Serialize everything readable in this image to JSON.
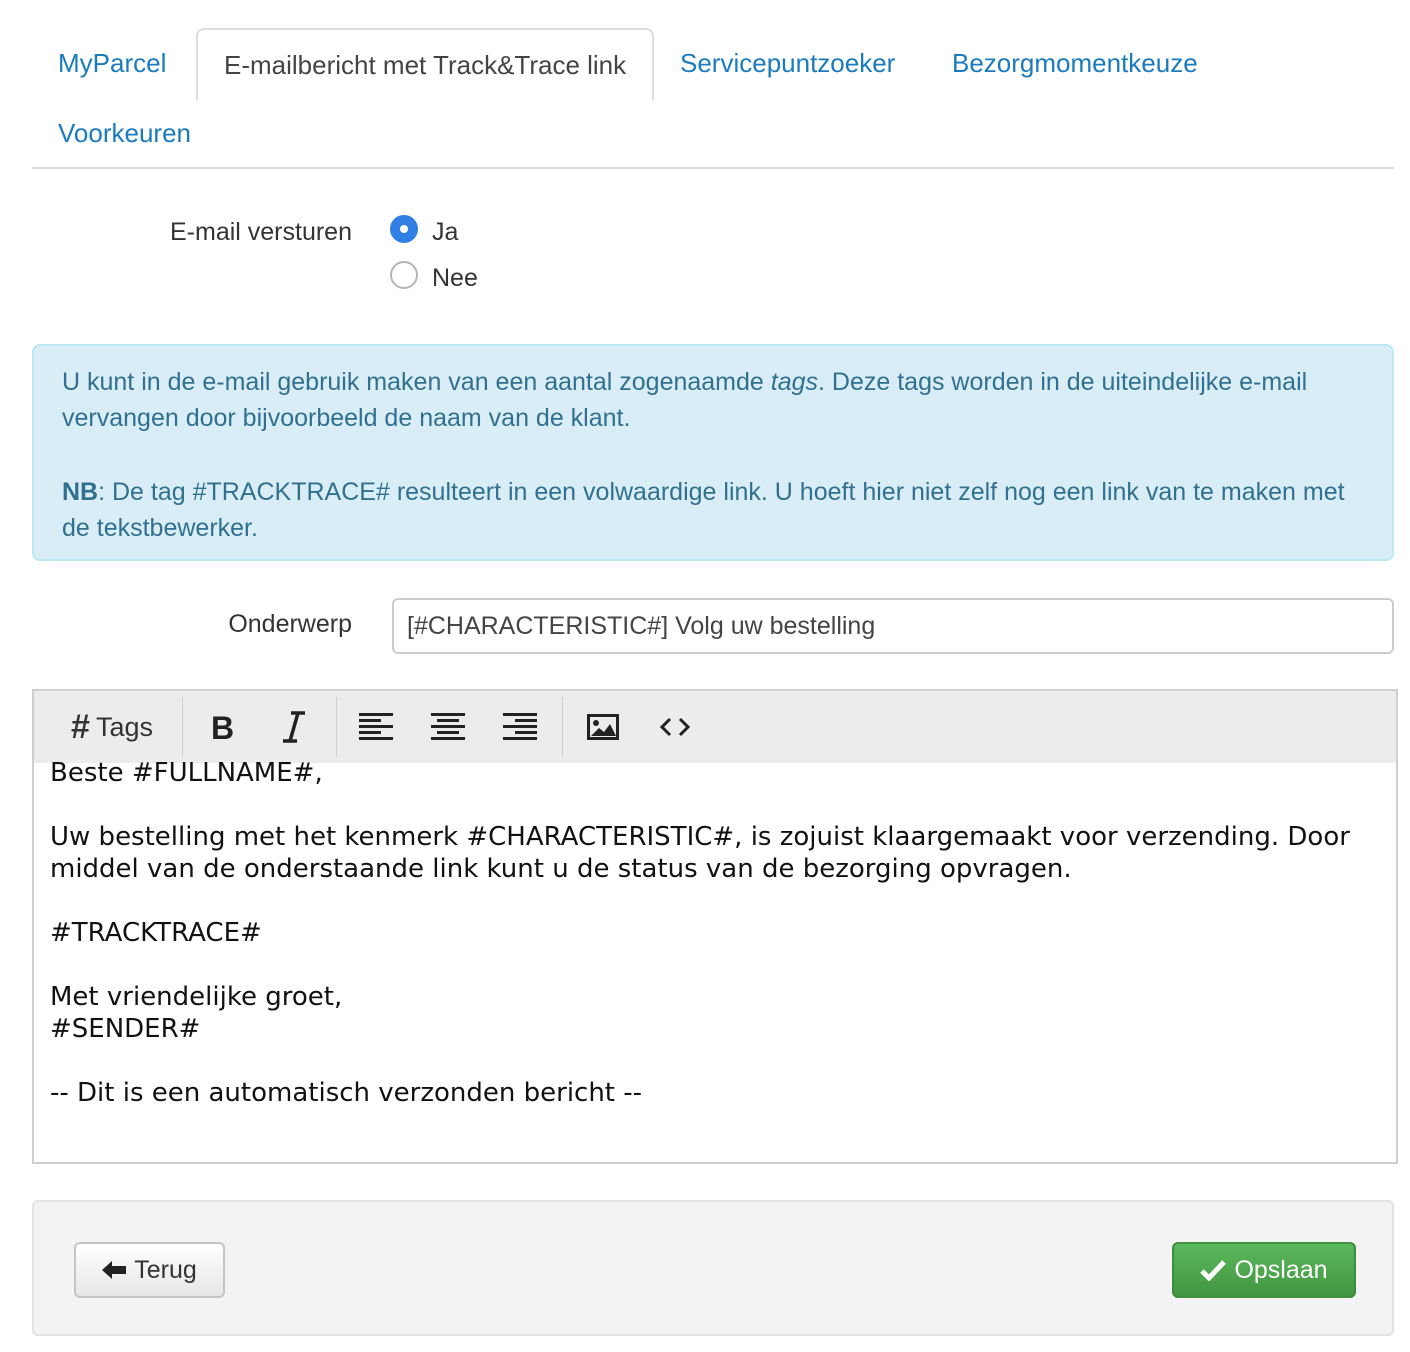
{
  "tabs": [
    {
      "label": "MyParcel",
      "active": false
    },
    {
      "label": "E-mailbericht met Track&Trace link",
      "active": true
    },
    {
      "label": "Servicepuntzoeker",
      "active": false
    },
    {
      "label": "Bezorgmomentkeuze",
      "active": false
    },
    {
      "label": "Voorkeuren",
      "active": false
    }
  ],
  "send_email": {
    "label": "E-mail versturen",
    "options": [
      {
        "label": "Ja",
        "checked": true
      },
      {
        "label": "Nee",
        "checked": false
      }
    ]
  },
  "info": {
    "p1_before": "U kunt in de e-mail gebruik maken van een aantal zogenaamde ",
    "p1_em": "tags",
    "p1_after": ". Deze tags worden in de uiteindelijke e-mail vervangen door bijvoorbeeld de naam van de klant.",
    "p2_bold": "NB",
    "p2_after": ": De tag #TRACKTRACE# resulteert in een volwaardige link. U hoeft hier niet zelf nog een link van te maken met de tekstbewerker."
  },
  "subject": {
    "label": "Onderwerp",
    "value": "[#CHARACTERISTIC#] Volg uw bestelling"
  },
  "toolbar": {
    "tags_label": "Tags"
  },
  "editor": {
    "body": "Beste #FULLNAME#,\n\nUw bestelling met het kenmerk #CHARACTERISTIC#, is zojuist klaargemaakt voor verzending. Door middel van de onderstaande link kunt u de status van de bezorging opvragen.\n\n#TRACKTRACE#\n\nMet vriendelijke groet,\n#SENDER#\n\n-- Dit is een automatisch verzonden bericht --"
  },
  "footer": {
    "back_label": "Terug",
    "save_label": "Opslaan"
  },
  "colors": {
    "link": "#1a7bbf",
    "info_bg": "#d9edf7",
    "info_text": "#31708f",
    "radio_checked": "#2f7fe5",
    "save_button": "#5cb85c"
  }
}
